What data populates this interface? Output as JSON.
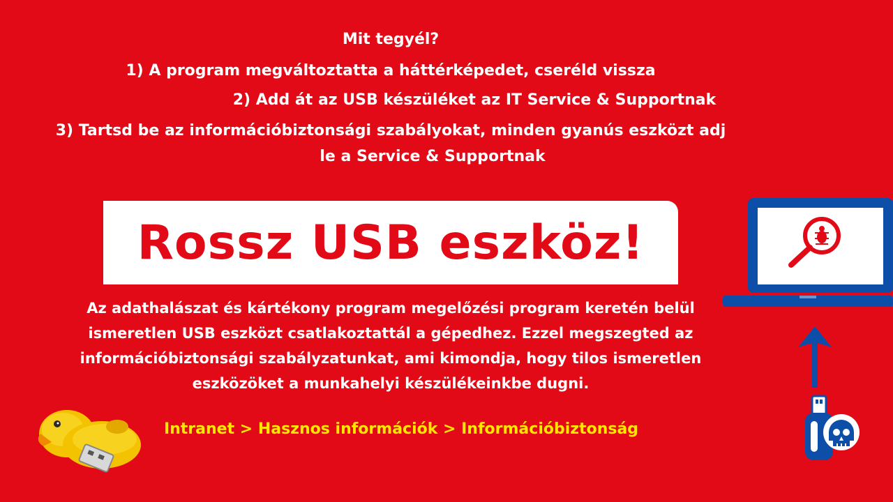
{
  "instructions": {
    "title": "Mit tegyél?",
    "step1": "1) A program megváltoztatta a háttérképedet, cseréld vissza",
    "step2": "2) Add át az USB készüléket az IT Service & Supportnak",
    "step3_line1": "3) Tartsd be az információbiztonsági szabályokat, minden gyanús eszközt adj",
    "step3_line2": "le a Service & Supportnak"
  },
  "banner": {
    "text": "Rossz USB eszköz!"
  },
  "body_text": "Az adathalászat és kártékony program megelőzési program keretén belül ismeretlen USB eszközt csatlakoztattál a gépedhez. Ezzel megszegted az információbiztonsági szabályzatunkat, ami kimondja, hogy tilos ismeretlen eszközöket a munkahelyi készülékeinkbe dugni.",
  "intranet_path": "Intranet > Hasznos információk > Információbiztonság",
  "icons": {
    "laptop": "laptop-malware-search-icon",
    "arrow": "arrow-up-icon",
    "usb_skull": "usb-skull-icon",
    "duck_usb": "duck-usb-drive-image"
  },
  "colors": {
    "background": "#e20a16",
    "banner_bg": "#ffffff",
    "banner_text": "#e20a16",
    "path_text": "#ffe600",
    "icon_blue": "#0d4fa8"
  }
}
